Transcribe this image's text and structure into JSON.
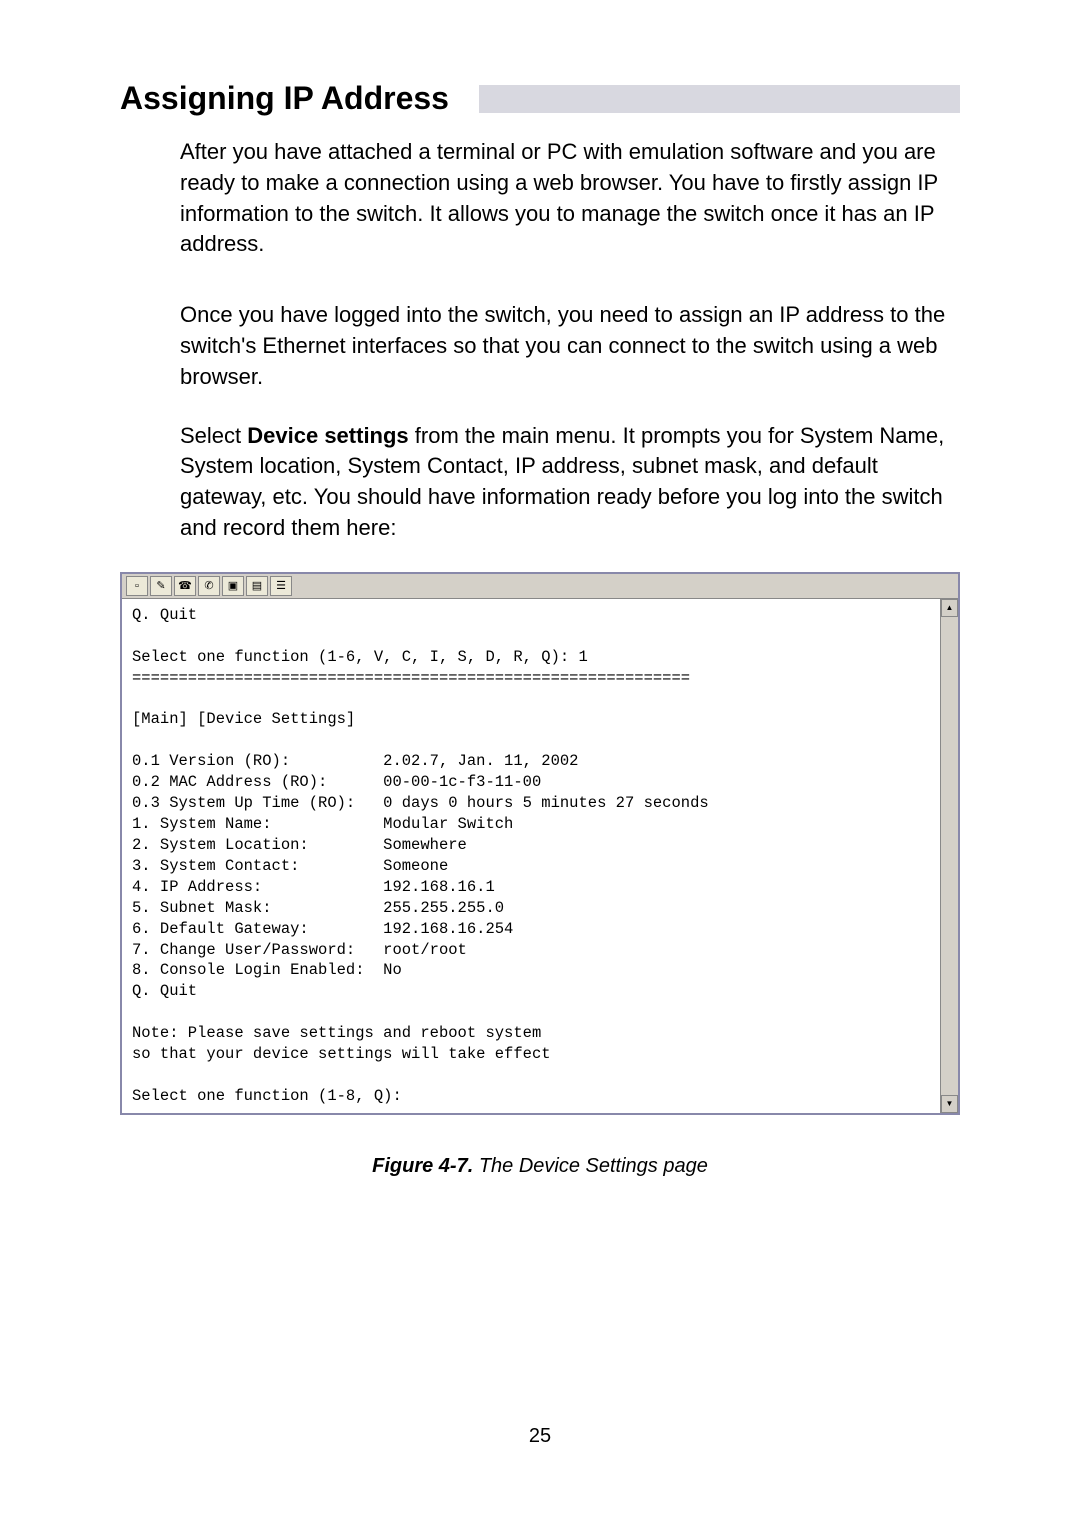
{
  "heading": "Assigning IP Address",
  "paras": {
    "p1": "After you have attached a terminal or PC with emulation software and you are ready to make a connection using a web browser. You have to firstly assign IP information to the switch. It allows you to manage the switch once it has an IP address.",
    "p2": "Once you have logged into the switch, you need to assign an IP address to the switch's Ethernet interfaces so that you can connect to the switch using a web browser.",
    "p3a": "Select ",
    "p3bold": "Device settings",
    "p3b": " from the main menu. It prompts you for System Name, System location, System Contact, IP address, subnet mask, and default gateway, etc. You should have information ready before you log into the switch and record them here:"
  },
  "toolbar_icons": [
    "new-icon",
    "open-icon",
    "connect-icon",
    "disconnect-icon",
    "send-icon",
    "receive-icon",
    "props-icon"
  ],
  "terminal": {
    "line01": "Q. Quit",
    "line02": "",
    "line03": "Select one function (1-6, V, C, I, S, D, R, Q): 1",
    "line04": "============================================================",
    "line05": "",
    "line06": "[Main] [Device Settings]",
    "line07": "",
    "line08": "0.1 Version (RO):          2.02.7, Jan. 11, 2002",
    "line09": "0.2 MAC Address (RO):      00-00-1c-f3-11-00",
    "line10": "0.3 System Up Time (RO):   0 days 0 hours 5 minutes 27 seconds",
    "line11": "1. System Name:            Modular Switch",
    "line12": "2. System Location:        Somewhere",
    "line13": "3. System Contact:         Someone",
    "line14": "4. IP Address:             192.168.16.1",
    "line15": "5. Subnet Mask:            255.255.255.0",
    "line16": "6. Default Gateway:        192.168.16.254",
    "line17": "7. Change User/Password:   root/root",
    "line18": "8. Console Login Enabled:  No",
    "line19": "Q. Quit",
    "line20": "",
    "line21": "Note: Please save settings and reboot system",
    "line22": "so that your device settings will take effect",
    "line23": "",
    "line24": "Select one function (1-8, Q):"
  },
  "figure": {
    "label": "Figure 4-7.",
    "caption": " The Device Settings page"
  },
  "page_number": "25"
}
